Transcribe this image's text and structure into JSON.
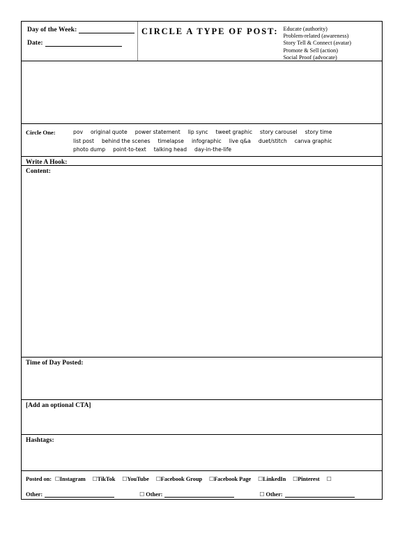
{
  "document": {
    "type": "content-planner-worksheet"
  },
  "header": {
    "day_label": "Day of the Week:",
    "date_label": "Date:",
    "title": "CIRCLE A TYPE OF POST:",
    "post_types": [
      "Educate (authority)",
      "Problem-related (awareness)",
      "Story Tell & Connect (avatar)",
      "Promote & Sell (action)",
      "Social Proof (advocate)"
    ]
  },
  "circle_one": {
    "label": "Circle One:",
    "rows": [
      [
        "pov",
        "original quote",
        "power statement",
        "lip sync",
        "tweet graphic",
        "story carousel",
        "story time"
      ],
      [
        "list post",
        "behind the scenes",
        "timelapse",
        "infographic",
        "live q&a",
        "duet/stitch",
        "canva graphic"
      ],
      [
        "photo dump",
        "point-to-text",
        "talking head",
        "day-in-the-life"
      ]
    ]
  },
  "sections": {
    "hook_label": "Write A Hook:",
    "content_label": "Content:",
    "time_label": "Time of Day Posted:",
    "cta_label": "[Add an optional CTA]",
    "hashtags_label": "Hashtags:"
  },
  "posted_on": {
    "lead_label": "Posted on:",
    "platforms": [
      "Instagram",
      "TikTok",
      "YouTube",
      "Facebook Group",
      "Facebook Page",
      "LinkedIn",
      "Pinterest"
    ],
    "trailing_checkbox": "□",
    "checkbox_glyph": "□",
    "other_label_1": "Other:",
    "other_label_2": "Other:",
    "other_label_3": "Other:"
  },
  "colors": {
    "ink": "#000000",
    "divider": "#8c8c8c",
    "paper": "#ffffff"
  }
}
